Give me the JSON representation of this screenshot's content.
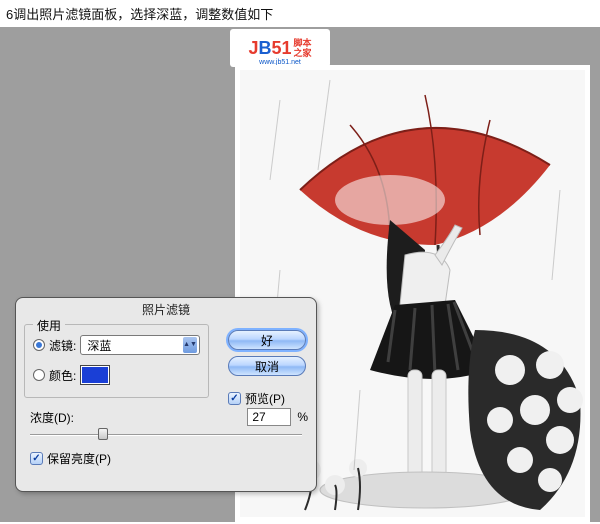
{
  "caption": "6调出照片滤镜面板，选择深蓝，调整数值如下",
  "logo": {
    "j": "J",
    "b": "B",
    "n51": "51",
    "side1": "脚本",
    "side2": "之家",
    "url": "www.jb51.net"
  },
  "dialog": {
    "title": "照片滤镜",
    "use_legend": "使用",
    "filter_label": "滤镜:",
    "filter_value": "深蓝",
    "color_label": "颜色:",
    "color_hex": "#1a3fd6",
    "ok": "好",
    "cancel": "取消",
    "preview": "预览(P)",
    "density_label": "浓度(D):",
    "density_value": "27",
    "density_unit": "%",
    "preserve": "保留亮度(P)"
  }
}
